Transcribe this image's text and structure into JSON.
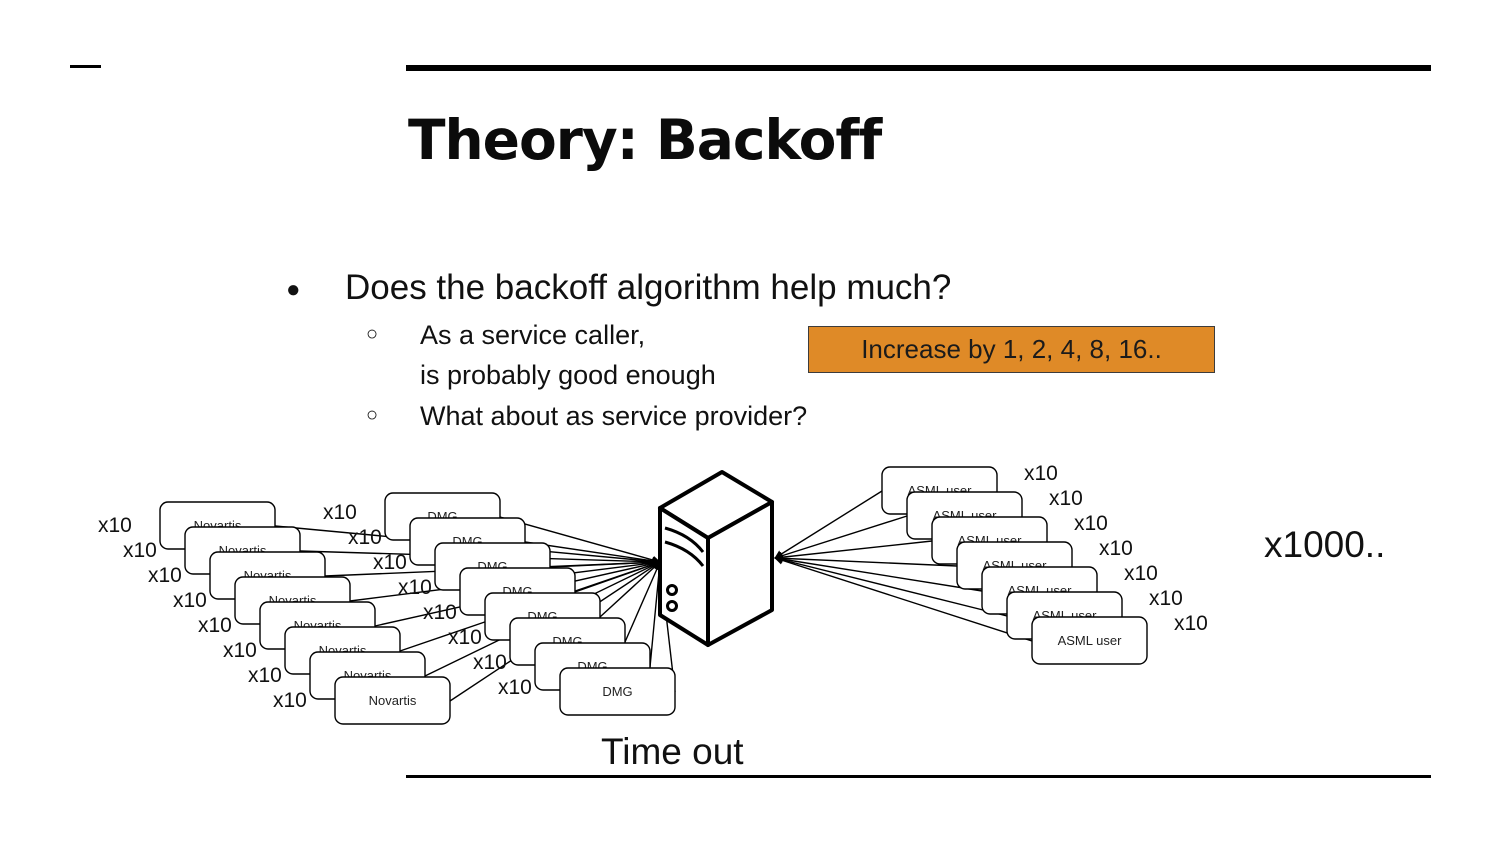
{
  "slide": {
    "title": "Theory: Backoff",
    "bullets": {
      "main": "Does the backoff algorithm help much?",
      "sub1_line1": "As a service caller,",
      "sub1_line2": "is probably good enough",
      "sub2": "What about as service provider?",
      "bullet_glyph": "●",
      "sub_bullet_glyph": "○"
    },
    "callout": {
      "text": "Increase by 1, 2, 4, 8, 16..",
      "color": "#df8a27"
    },
    "multiplier_large": "x1000..",
    "timeout_label": "Time out"
  },
  "diagram": {
    "server_icon": "server-tower-icon",
    "client_groups": [
      {
        "name": "Novartis",
        "multiplier": "x10",
        "count": 8
      },
      {
        "name": "DMG",
        "multiplier": "x10",
        "count": 8
      },
      {
        "name": "ASML user",
        "multiplier": "x10",
        "count": 7
      }
    ]
  }
}
